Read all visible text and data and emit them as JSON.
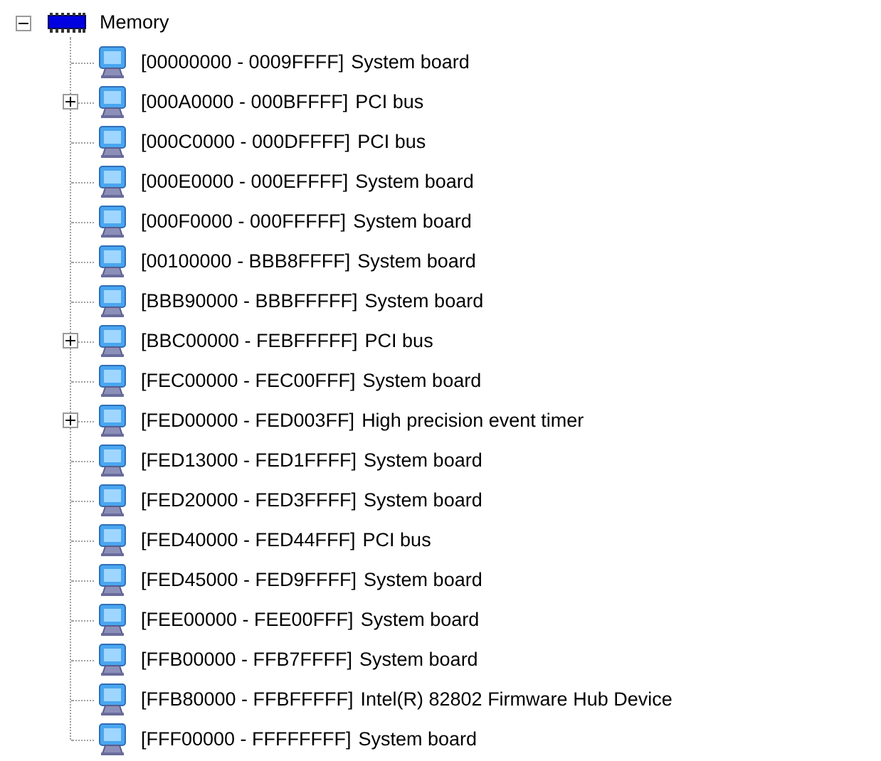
{
  "tree": {
    "label": "Memory",
    "expanded": true,
    "children": [
      {
        "range": "[00000000 - 0009FFFF]",
        "device": "System board"
      },
      {
        "range": "[000A0000 - 000BFFFF]",
        "device": "PCI bus",
        "expanded": false
      },
      {
        "range": "[000C0000 - 000DFFFF]",
        "device": "PCI bus"
      },
      {
        "range": "[000E0000 - 000EFFFF]",
        "device": "System board"
      },
      {
        "range": "[000F0000 - 000FFFFF]",
        "device": "System board"
      },
      {
        "range": "[00100000 - BBB8FFFF]",
        "device": "System board"
      },
      {
        "range": "[BBB90000 - BBBFFFFF]",
        "device": "System board"
      },
      {
        "range": "[BBC00000 - FEBFFFFF]",
        "device": "PCI bus",
        "expanded": false
      },
      {
        "range": "[FEC00000 - FEC00FFF]",
        "device": "System board"
      },
      {
        "range": "[FED00000 - FED003FF]",
        "device": "High precision event timer",
        "expanded": false
      },
      {
        "range": "[FED13000 - FED1FFFF]",
        "device": "System board"
      },
      {
        "range": "[FED20000 - FED3FFFF]",
        "device": "System board"
      },
      {
        "range": "[FED40000 - FED44FFF]",
        "device": "PCI bus"
      },
      {
        "range": "[FED45000 - FED9FFFF]",
        "device": "System board"
      },
      {
        "range": "[FEE00000 - FEE00FFF]",
        "device": "System board"
      },
      {
        "range": "[FFB00000 - FFB7FFFF]",
        "device": "System board"
      },
      {
        "range": "[FFB80000 - FFBFFFFF]",
        "device": "Intel(R) 82802 Firmware Hub Device"
      },
      {
        "range": "[FFF00000 - FFFFFFFF]",
        "device": "System board"
      }
    ]
  }
}
